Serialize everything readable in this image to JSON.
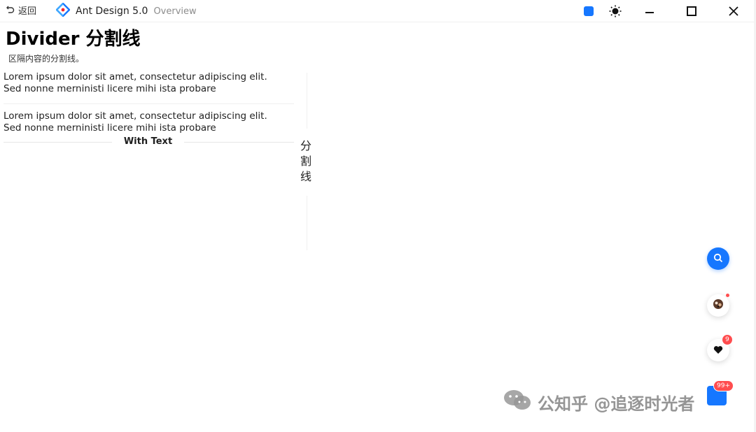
{
  "titlebar": {
    "back_label": "返回",
    "app_name": "Ant Design 5.0",
    "app_sub": "Overview",
    "theme_color": "#1677ff"
  },
  "page": {
    "title": "Divider 分割线",
    "description": "区隔内容的分割线。"
  },
  "content": {
    "paragraph_1": "Lorem ipsum dolor sit amet, consectetur adipiscing elit. Sed nonne merninisti licere mihi ista probare",
    "paragraph_2": "Lorem ipsum dolor sit amet, consectetur adipiscing elit. Sed nonne merninisti licere mihi ista probare",
    "with_text_label": "With Text",
    "vertical_chars": [
      "分",
      "割",
      "线"
    ]
  },
  "float_buttons": {
    "heart_badge": "9",
    "bottom_badge": "99+"
  },
  "watermark": {
    "text": "公知乎 @追逐时光者"
  },
  "icons": [
    "undo-icon",
    "antd-logo-icon",
    "color-swatch-icon",
    "sun-icon",
    "minimize-icon",
    "maximize-icon",
    "close-icon",
    "search-icon",
    "avatar-icon",
    "heart-icon",
    "wechat-icon"
  ]
}
